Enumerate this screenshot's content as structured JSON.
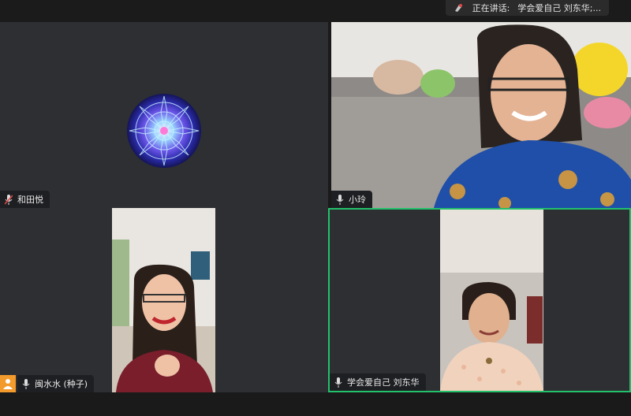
{
  "speaking_indicator": {
    "label": "正在讲话:",
    "speaker": "学会爱自己 刘东华;..."
  },
  "participants": [
    {
      "name": "和田悦",
      "mic": "muted",
      "video": "off"
    },
    {
      "name": "小玲",
      "mic": "on",
      "video": "on"
    },
    {
      "name": "闽水水 (种子)",
      "mic": "on",
      "video": "on"
    },
    {
      "name": "学会爱自己 刘东华",
      "mic": "on",
      "video": "on",
      "active_speaker": true
    }
  ],
  "colors": {
    "active_border": "#23c16b",
    "tile_bg": "#2d2f33",
    "avatar_badge": "#f39a2c"
  },
  "icons": [
    "speaker-icon",
    "mic-muted-icon",
    "mic-icon",
    "avatar-icon",
    "mandala-avatar"
  ]
}
